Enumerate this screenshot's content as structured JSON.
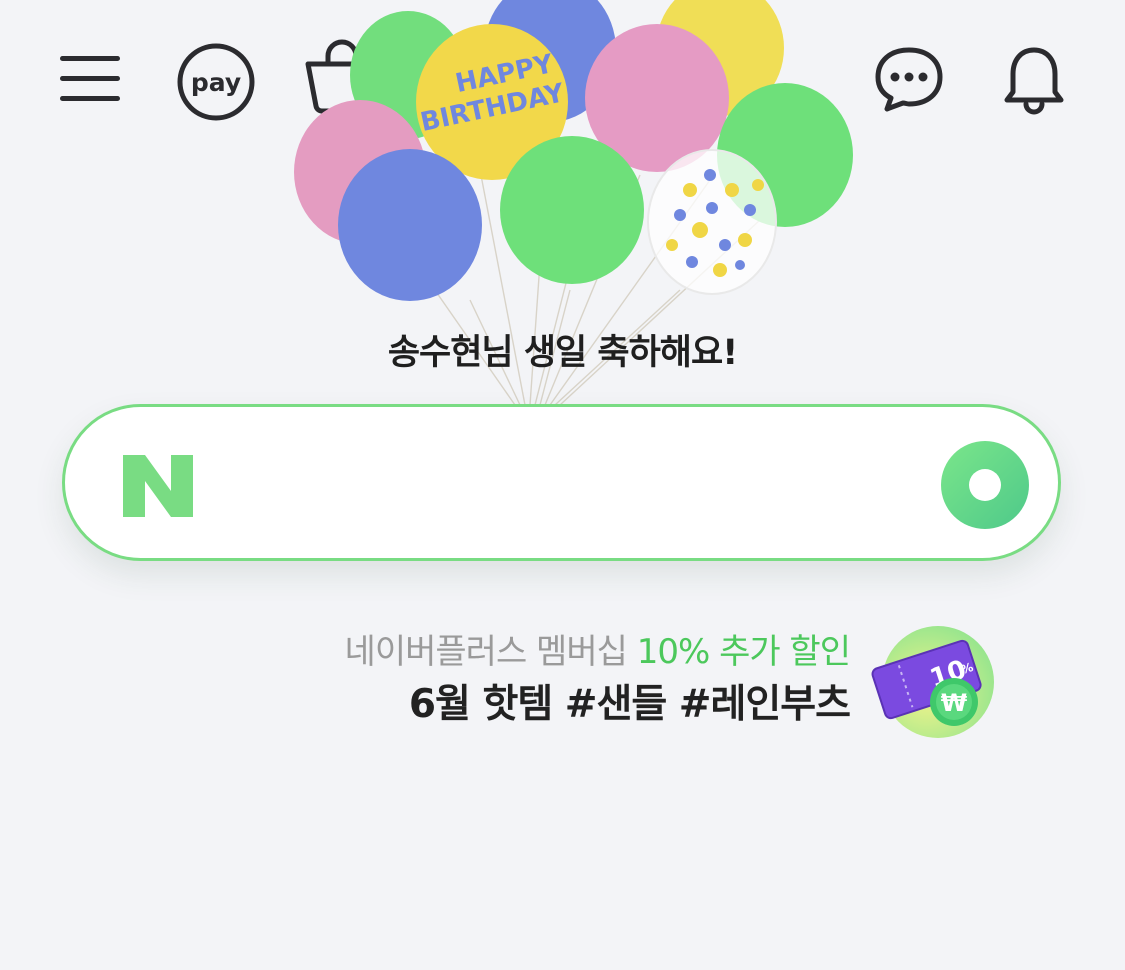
{
  "header": {
    "menu_icon": "hamburger-menu-icon",
    "pay_icon": "pay-icon",
    "pay_label": "pay",
    "cart_icon": "shopping-bag-icon",
    "cart_badge_color": "#f04a3b",
    "talk_icon": "chat-bubble-icon",
    "bell_icon": "bell-icon"
  },
  "banner": {
    "balloon_text_line1": "HAPPY",
    "balloon_text_line2": "BIRTHDAY",
    "message": "송수현님 생일 축하해요!"
  },
  "search": {
    "logo_text": "N",
    "placeholder": "",
    "value": "",
    "accent_color": "#79dc83"
  },
  "promo": {
    "line1_prefix": "네이버플러스 멤버십 ",
    "line1_highlight": "10% 추가 할인",
    "line2": "6월 핫템 #샌들 #레인부츠",
    "coupon_percent": "10",
    "coupon_percent_sign": "%"
  },
  "colors": {
    "background": "#f3f4f7",
    "naver_green": "#79dc83",
    "text_dark": "#222222",
    "text_gray": "#9a9a9a",
    "highlight_green": "#4cc85c"
  }
}
